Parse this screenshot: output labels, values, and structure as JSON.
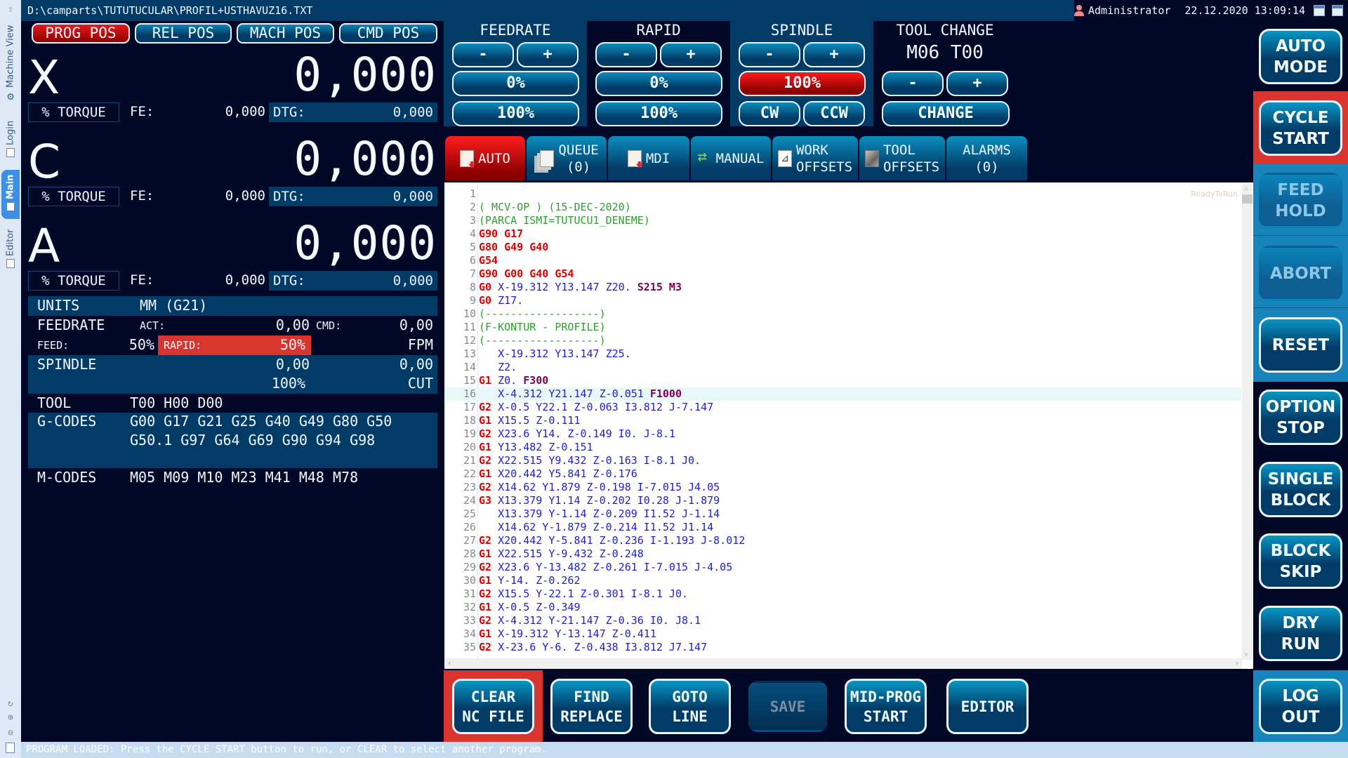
{
  "titlebar": {
    "path": "D:\\camparts\\TUTUTUCULAR\\PROFIL+USTHAVUZ16.TXT",
    "user": "Administrator",
    "datetime": "22.12.2020 13:09:14"
  },
  "side_tabs": [
    {
      "label": "Machine View",
      "active": false
    },
    {
      "label": "Login",
      "active": false
    },
    {
      "label": "Main",
      "active": true
    },
    {
      "label": "Editor",
      "active": false
    }
  ],
  "position_modes": [
    {
      "label": "PROG POS",
      "active": true
    },
    {
      "label": "REL POS",
      "active": false
    },
    {
      "label": "MACH POS",
      "active": false
    },
    {
      "label": "CMD POS",
      "active": false
    }
  ],
  "axes": [
    {
      "name": "X",
      "value": "0,000",
      "torque_label": "% TORQUE",
      "fe_label": "FE:",
      "fe_value": "0,000",
      "dtg_label": "DTG:",
      "dtg_value": "0,000"
    },
    {
      "name": "C",
      "value": "0,000",
      "torque_label": "% TORQUE",
      "fe_label": "FE:",
      "fe_value": "0,000",
      "dtg_label": "DTG:",
      "dtg_value": "0,000"
    },
    {
      "name": "A",
      "value": "0,000",
      "torque_label": "% TORQUE",
      "fe_label": "FE:",
      "fe_value": "0,000",
      "dtg_label": "DTG:",
      "dtg_value": "0,000"
    }
  ],
  "info": {
    "units_label": "UNITS",
    "units_value": "MM (G21)",
    "feedrate_label": "FEEDRATE",
    "act_label": "ACT:",
    "act_value": "0,00",
    "cmd_label": "CMD:",
    "cmd_value": "0,00",
    "feed_label": "FEED:",
    "feed_value": "50%",
    "rapid_label": "RAPID:",
    "rapid_value": "50%",
    "feed_units": "FPM",
    "spindle_label": "SPINDLE",
    "spindle_act": "0,00",
    "spindle_cmd": "0,00",
    "spindle_override": "100%",
    "spindle_mode": "CUT",
    "tool_label": "TOOL",
    "tool_value": "T00 H00 D00",
    "gcodes_label": "G-CODES",
    "gcodes_line1": "G00 G17 G21 G25 G40 G49 G80 G50",
    "gcodes_line2": "G50.1 G97 G64 G69 G90 G94 G98",
    "mcodes_label": "M-CODES",
    "mcodes_value": "M05 M09 M10 M23 M41 M48 M78"
  },
  "overrides": {
    "feedrate": {
      "title": "FEEDRATE",
      "minus": "-",
      "plus": "+",
      "value": "0%",
      "reset": "100%"
    },
    "rapid": {
      "title": "RAPID",
      "minus": "-",
      "plus": "+",
      "value": "0%",
      "reset": "100%"
    },
    "spindle": {
      "title": "SPINDLE",
      "minus": "-",
      "plus": "+",
      "value": "100%",
      "cw": "CW",
      "ccw": "CCW"
    },
    "tool_change": {
      "title": "TOOL CHANGE",
      "value": "M06 T00",
      "minus": "-",
      "plus": "+",
      "change": "CHANGE"
    }
  },
  "tabs": [
    {
      "label": "AUTO",
      "icon": "document-run-icon",
      "active": true
    },
    {
      "label": "QUEUE\n(0)",
      "icon": "queue-icon",
      "active": false
    },
    {
      "label": "MDI",
      "icon": "mdi-document-icon",
      "active": false
    },
    {
      "label": "MANUAL",
      "icon": "arrows-exchange-icon",
      "active": false
    },
    {
      "label": "WORK\nOFFSETS",
      "icon": "axes-icon",
      "active": false
    },
    {
      "label": "TOOL\nOFFSETS",
      "icon": "tool-icon",
      "active": false
    },
    {
      "label": "ALARMS\n(0)",
      "icon": "",
      "active": false
    }
  ],
  "editor": {
    "status_hint": "ReadyToRun",
    "current_line": 16,
    "lines": [
      [],
      [
        [
          "c",
          "( MCV-OP ) (15-DEC-2020)"
        ]
      ],
      [
        [
          "c",
          "(PARCA ISMI=TUTUCU1_DENEME)"
        ]
      ],
      [
        [
          "g",
          "G90 G17"
        ]
      ],
      [
        [
          "g",
          "G80 G49 G40"
        ]
      ],
      [
        [
          "g",
          "G54"
        ]
      ],
      [
        [
          "g",
          "G90 G00 G40 G54"
        ]
      ],
      [
        [
          "g",
          "G0"
        ],
        [
          "p",
          " X-19.312 Y13.147 Z20. "
        ],
        [
          "f",
          "S215 M3"
        ]
      ],
      [
        [
          "g",
          "G0"
        ],
        [
          "p",
          " Z17."
        ]
      ],
      [
        [
          "c",
          "(------------------)"
        ]
      ],
      [
        [
          "c",
          "(F-KONTUR - PROFILE)"
        ]
      ],
      [
        [
          "c",
          "(------------------)"
        ]
      ],
      [
        [
          "p",
          "   X-19.312 Y13.147 Z25."
        ]
      ],
      [
        [
          "p",
          "   Z2."
        ]
      ],
      [
        [
          "g",
          "G1"
        ],
        [
          "p",
          " Z0. "
        ],
        [
          "f",
          "F300"
        ]
      ],
      [
        [
          "p",
          "   X-4.312 Y21.147 Z-0.051 "
        ],
        [
          "f",
          "F1000"
        ]
      ],
      [
        [
          "g",
          "G2"
        ],
        [
          "p",
          " X-0.5 Y22.1 Z-0.063 I3.812 J-7.147"
        ]
      ],
      [
        [
          "g",
          "G1"
        ],
        [
          "p",
          " X15.5 Z-0.111"
        ]
      ],
      [
        [
          "g",
          "G2"
        ],
        [
          "p",
          " X23.6 Y14. Z-0.149 I0. J-8.1"
        ]
      ],
      [
        [
          "g",
          "G1"
        ],
        [
          "p",
          " Y13.482 Z-0.151"
        ]
      ],
      [
        [
          "g",
          "G2"
        ],
        [
          "p",
          " X22.515 Y9.432 Z-0.163 I-8.1 J0."
        ]
      ],
      [
        [
          "g",
          "G1"
        ],
        [
          "p",
          " X20.442 Y5.841 Z-0.176"
        ]
      ],
      [
        [
          "g",
          "G2"
        ],
        [
          "p",
          " X14.62 Y1.879 Z-0.198 I-7.015 J4.05"
        ]
      ],
      [
        [
          "g",
          "G3"
        ],
        [
          "p",
          " X13.379 Y1.14 Z-0.202 I0.28 J-1.879"
        ]
      ],
      [
        [
          "p",
          "   X13.379 Y-1.14 Z-0.209 I1.52 J-1.14"
        ]
      ],
      [
        [
          "p",
          "   X14.62 Y-1.879 Z-0.214 I1.52 J1.14"
        ]
      ],
      [
        [
          "g",
          "G2"
        ],
        [
          "p",
          " X20.442 Y-5.841 Z-0.236 I-1.193 J-8.012"
        ]
      ],
      [
        [
          "g",
          "G1"
        ],
        [
          "p",
          " X22.515 Y-9.432 Z-0.248"
        ]
      ],
      [
        [
          "g",
          "G2"
        ],
        [
          "p",
          " X23.6 Y-13.482 Z-0.261 I-7.015 J-4.05"
        ]
      ],
      [
        [
          "g",
          "G1"
        ],
        [
          "p",
          " Y-14. Z-0.262"
        ]
      ],
      [
        [
          "g",
          "G2"
        ],
        [
          "p",
          " X15.5 Y-22.1 Z-0.301 I-8.1 J0."
        ]
      ],
      [
        [
          "g",
          "G1"
        ],
        [
          "p",
          " X-0.5 Z-0.349"
        ]
      ],
      [
        [
          "g",
          "G2"
        ],
        [
          "p",
          " X-4.312 Y-21.147 Z-0.36 I0. J8.1"
        ]
      ],
      [
        [
          "g",
          "G1"
        ],
        [
          "p",
          " X-19.312 Y-13.147 Z-0.411"
        ]
      ],
      [
        [
          "g",
          "G2"
        ],
        [
          "p",
          " X-23.6 Y-6. Z-0.438 I3.812 J7.147"
        ]
      ]
    ]
  },
  "side_buttons": [
    {
      "label": "AUTO\nMODE",
      "disabled": false
    },
    {
      "label": "CYCLE\nSTART",
      "disabled": false,
      "highlight": "#d8352f"
    },
    {
      "label": "FEED\nHOLD",
      "disabled": true
    },
    {
      "label": "ABORT",
      "disabled": true
    },
    {
      "label": "RESET",
      "disabled": false
    },
    {
      "label": "OPTION\nSTOP",
      "disabled": false
    },
    {
      "label": "SINGLE\nBLOCK",
      "disabled": false
    },
    {
      "label": "BLOCK\nSKIP",
      "disabled": false
    },
    {
      "label": "DRY\nRUN",
      "disabled": false
    },
    {
      "label": "LOG OUT",
      "disabled": false
    }
  ],
  "bottom_buttons": [
    {
      "label": "CLEAR\nNC FILE",
      "disabled": false,
      "highlight": "#d8352f"
    },
    {
      "label": "FIND\nREPLACE",
      "disabled": false
    },
    {
      "label": "GOTO\nLINE",
      "disabled": false
    },
    {
      "label": "SAVE",
      "disabled": true
    },
    {
      "label": "MID-PROG\nSTART",
      "disabled": false
    },
    {
      "label": "EDITOR",
      "disabled": false
    }
  ],
  "status_message": "PROGRAM LOADED:  Press the CYCLE START button to run, or CLEAR to select another program.",
  "colors": {
    "background": "#020826",
    "panel": "#023b66",
    "active_red": "#e41b1b",
    "highlight_red": "#d8352f",
    "side_panel": "#1784bb",
    "status_bar": "#c5dcf0"
  }
}
